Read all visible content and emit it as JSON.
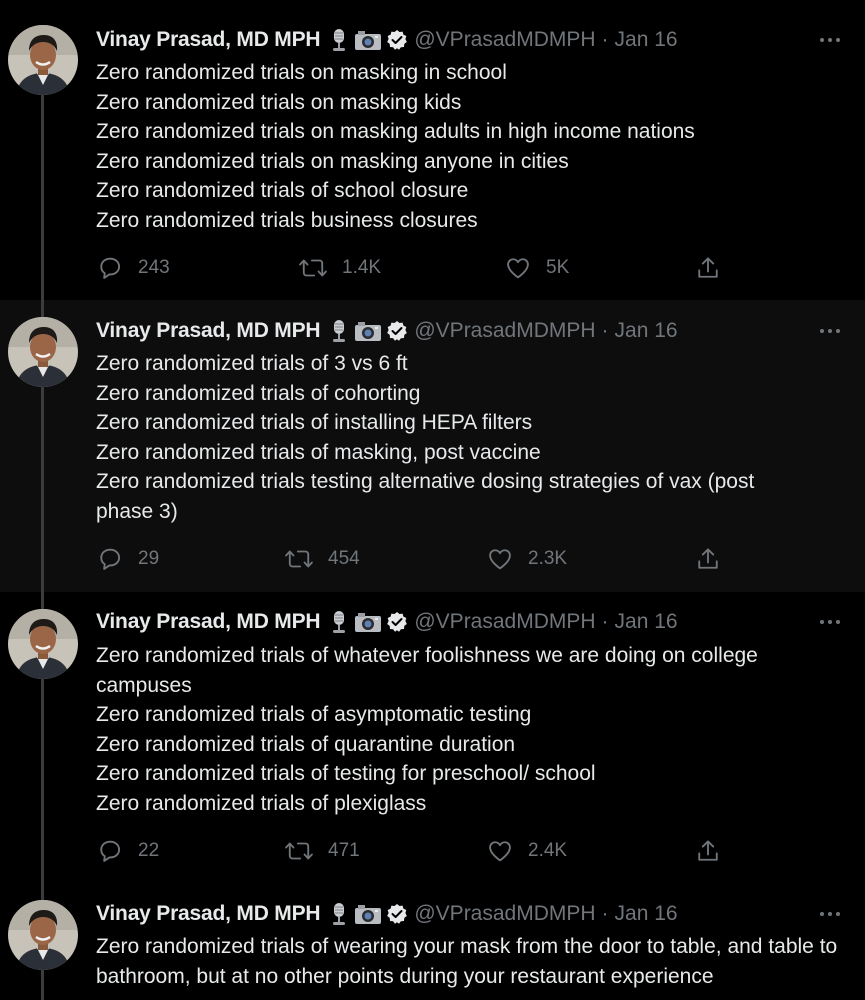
{
  "tweets": [
    {
      "name": "Vinay Prasad, MD MPH",
      "handle": "@VPrasadMDMPH",
      "separator": "·",
      "date": "Jan 16",
      "lines": [
        "Zero randomized trials on masking in school",
        "Zero randomized trials on masking kids",
        "Zero randomized trials on masking adults in high income nations",
        "Zero randomized trials on masking anyone in cities",
        "Zero randomized trials of school closure",
        "Zero randomized trials business closures"
      ],
      "replies": "243",
      "retweets": "1.4K",
      "likes": "5K"
    },
    {
      "name": "Vinay Prasad, MD MPH",
      "handle": "@VPrasadMDMPH",
      "separator": "·",
      "date": "Jan 16",
      "lines": [
        "Zero randomized trials of 3 vs 6 ft",
        "Zero randomized trials of cohorting",
        "Zero randomized trials of installing HEPA filters",
        "Zero randomized trials of masking, post vaccine",
        "Zero randomized trials testing alternative dosing strategies of vax (post phase 3)"
      ],
      "replies": "29",
      "retweets": "454",
      "likes": "2.3K"
    },
    {
      "name": "Vinay Prasad, MD MPH",
      "handle": "@VPrasadMDMPH",
      "separator": "·",
      "date": "Jan 16",
      "lines": [
        "Zero randomized trials of whatever foolishness we are doing on college campuses",
        "Zero randomized trials of asymptomatic testing",
        "Zero randomized trials of quarantine duration",
        "Zero randomized trials of testing for preschool/ school",
        "Zero randomized trials of plexiglass"
      ],
      "replies": "22",
      "retweets": "471",
      "likes": "2.4K"
    },
    {
      "name": "Vinay Prasad, MD MPH",
      "handle": "@VPrasadMDMPH",
      "separator": "·",
      "date": "Jan 16",
      "lines": [
        "Zero randomized trials of wearing your mask from the door to table, and table to bathroom, but at no other points during your restaurant experience"
      ]
    }
  ],
  "icons": {
    "name_emojis": [
      "microphone-icon",
      "camera-icon"
    ],
    "verified": "verified-badge-icon",
    "more": "more-options-icon",
    "reply": "reply-icon",
    "retweet": "retweet-icon",
    "like": "like-icon",
    "share": "share-icon"
  },
  "colors": {
    "background": "#000000",
    "highlight_background": "#0d0d0e",
    "primary_text": "#e7e9ea",
    "secondary_text": "#71767b",
    "thread_line": "#3a3d40"
  }
}
